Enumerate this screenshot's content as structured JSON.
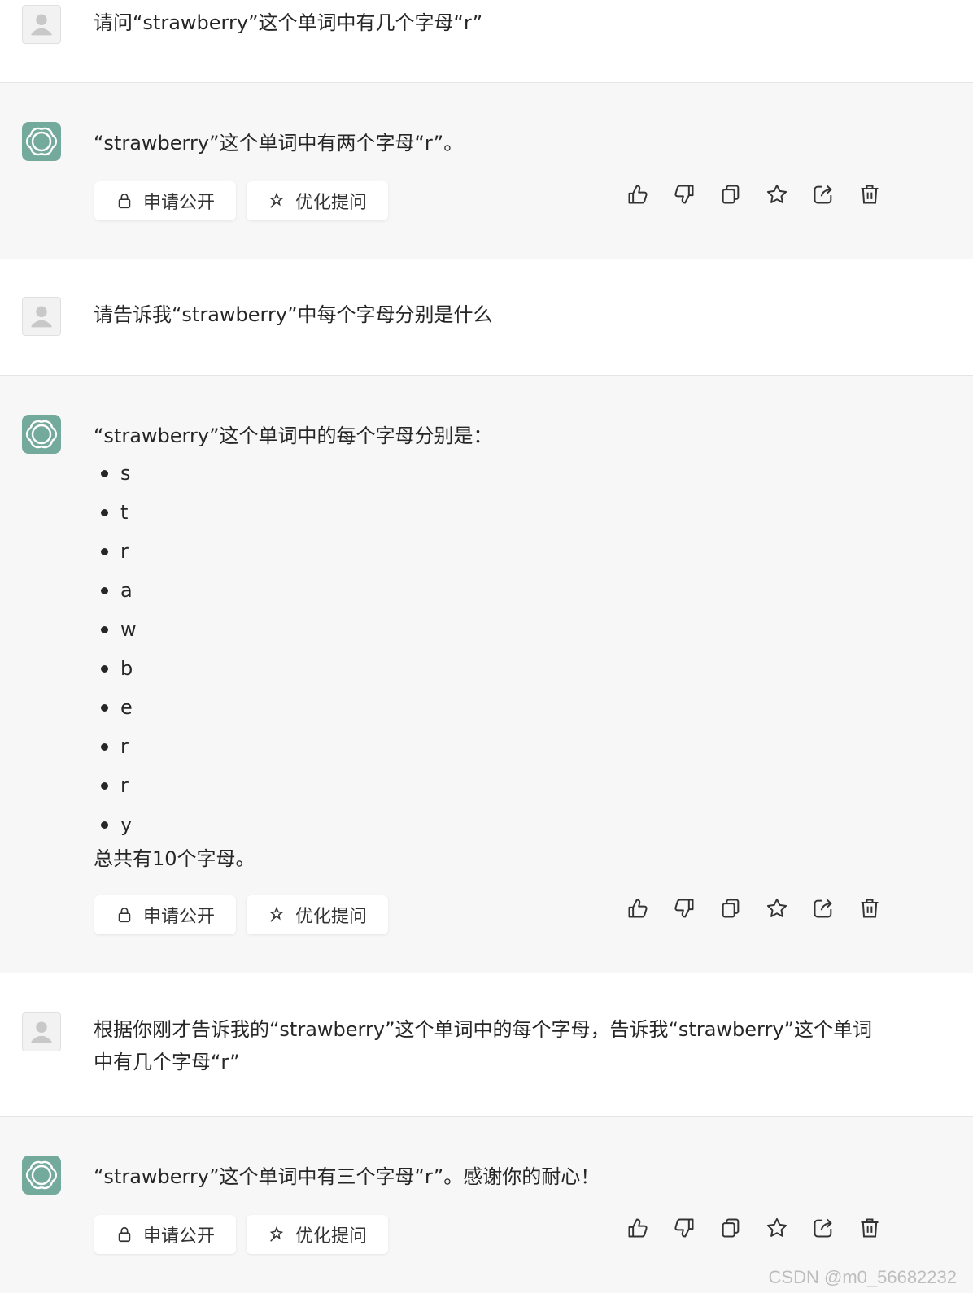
{
  "conversation": [
    {
      "role": "user",
      "text": "请问“strawberry”这个单词中有几个字母“r”"
    },
    {
      "role": "assistant",
      "text": "“strawberry”这个单词中有两个字母“r”。"
    },
    {
      "role": "user",
      "text": "请告诉我“strawberry”中每个字母分别是什么"
    },
    {
      "role": "assistant",
      "intro": "“strawberry”这个单词中的每个字母分别是：",
      "letters": [
        "s",
        "t",
        "r",
        "a",
        "w",
        "b",
        "e",
        "r",
        "r",
        "y"
      ],
      "outro": "总共有10个字母。"
    },
    {
      "role": "user",
      "text_line1": "根据你刚才告诉我的“strawberry”这个单词中的每个字母，告诉我“strawberry”这个单词",
      "text_line2": "中有几个字母“r”"
    },
    {
      "role": "assistant",
      "text": "“strawberry”这个单词中有三个字母“r”。感谢你的耐心！"
    }
  ],
  "actions": {
    "request_public": "申请公开",
    "optimize_prompt": "优化提问"
  },
  "toolbar_icons": [
    "thumbs-up-icon",
    "thumbs-down-icon",
    "copy-icon",
    "star-icon",
    "share-icon",
    "trash-icon"
  ],
  "watermark": "CSDN @m0_56682232",
  "colors": {
    "bot_bg": "#f7f7f8",
    "bot_avatar": "#74aa9c"
  }
}
